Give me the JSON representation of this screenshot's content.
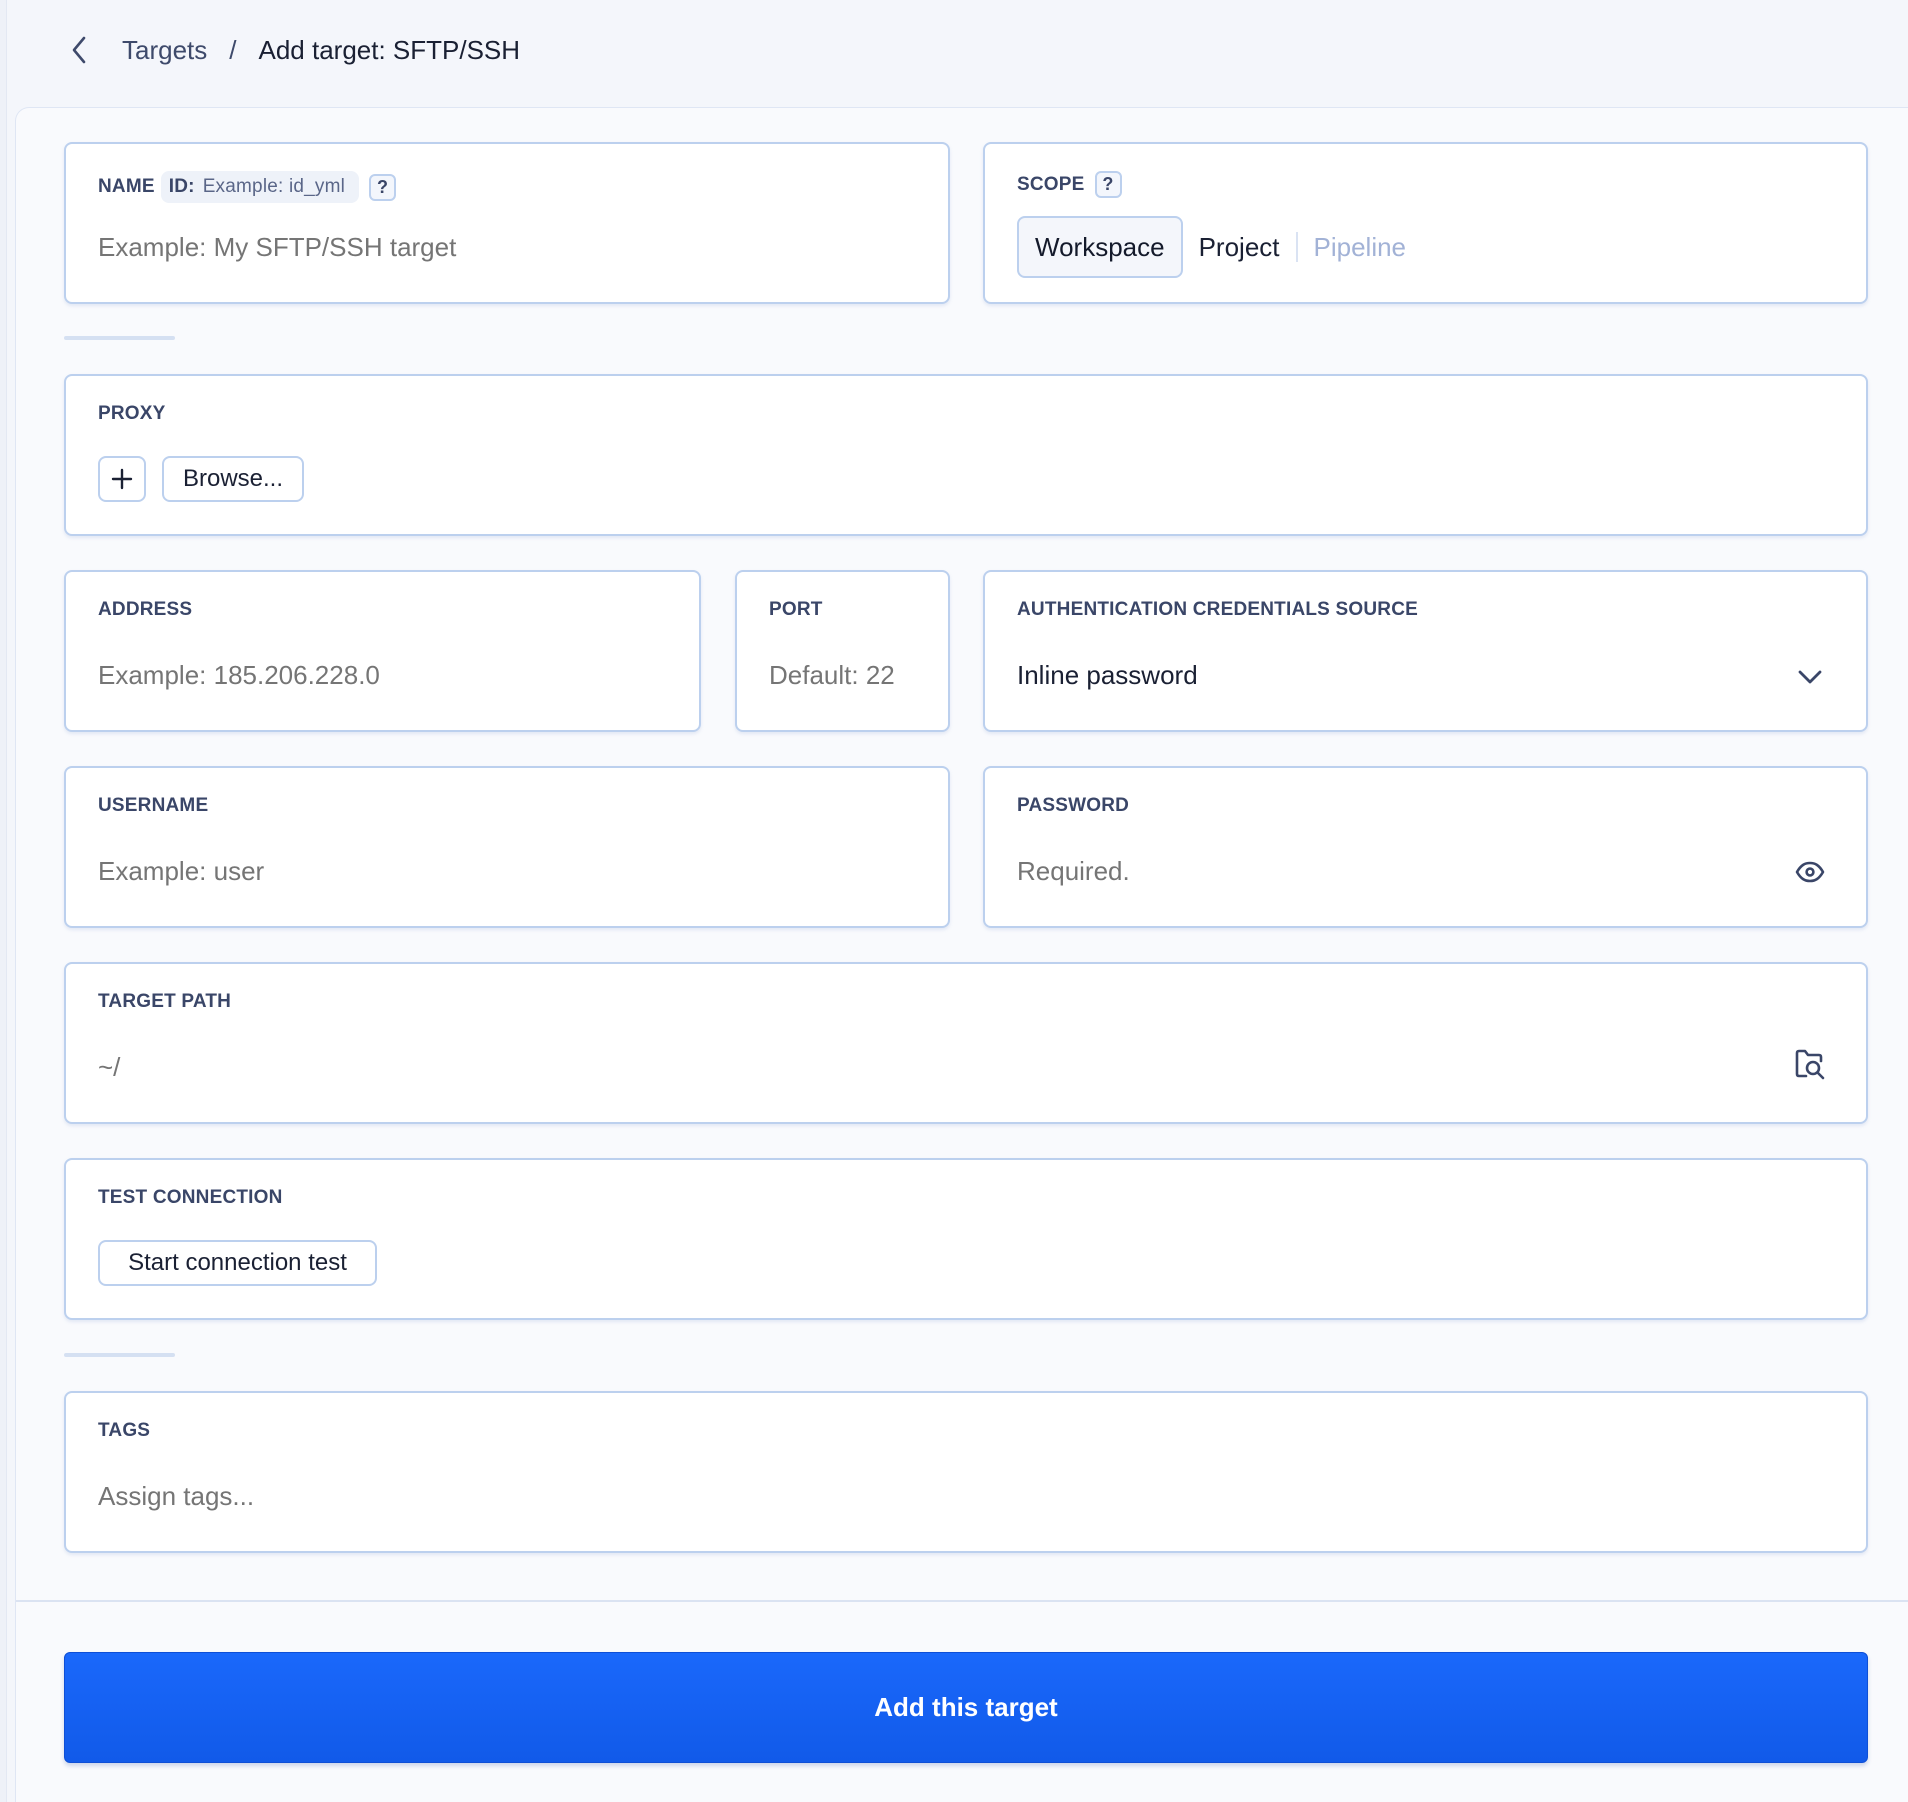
{
  "breadcrumb": {
    "back_icon": "chevron-left-icon",
    "parent": "Targets",
    "separator": "/",
    "current": "Add target: SFTP/SSH"
  },
  "name_field": {
    "label": "NAME",
    "id_key": "ID:",
    "id_placeholder": "Example: id_yml",
    "help": "?",
    "placeholder": "Example: My SFTP/SSH target"
  },
  "scope": {
    "label": "SCOPE",
    "help": "?",
    "options": [
      {
        "label": "Workspace",
        "state": "selected"
      },
      {
        "label": "Project",
        "state": "enabled"
      },
      {
        "label": "Pipeline",
        "state": "disabled"
      }
    ]
  },
  "proxy": {
    "label": "PROXY",
    "add_icon": "plus-icon",
    "browse_label": "Browse..."
  },
  "address": {
    "label": "ADDRESS",
    "placeholder": "Example: 185.206.228.0"
  },
  "port": {
    "label": "PORT",
    "placeholder": "Default: 22"
  },
  "auth_source": {
    "label": "AUTHENTICATION CREDENTIALS SOURCE",
    "selected": "Inline password",
    "icon": "chevron-down-icon"
  },
  "username": {
    "label": "USERNAME",
    "placeholder": "Example: user"
  },
  "password": {
    "label": "PASSWORD",
    "placeholder": "Required.",
    "icon": "eye-icon"
  },
  "target_path": {
    "label": "TARGET PATH",
    "placeholder": "~/",
    "icon": "folder-search-icon"
  },
  "test_connection": {
    "label": "TEST CONNECTION",
    "button_label": "Start connection test"
  },
  "tags": {
    "label": "TAGS",
    "placeholder": "Assign tags..."
  },
  "submit": {
    "label": "Add this target"
  },
  "colors": {
    "primary": "#1a68fb",
    "border": "#bcd0ee",
    "placeholder": "#7484b4",
    "label": "#3a4668"
  }
}
